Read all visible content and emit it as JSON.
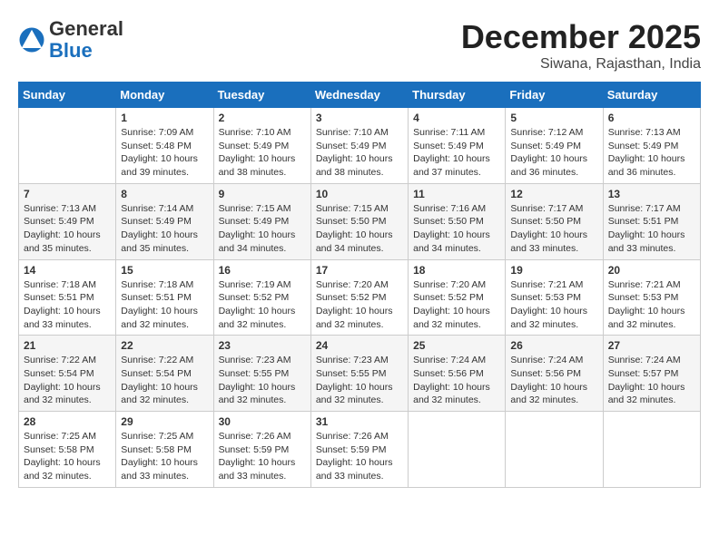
{
  "logo": {
    "general": "General",
    "blue": "Blue"
  },
  "title": "December 2025",
  "location": "Siwana, Rajasthan, India",
  "days_of_week": [
    "Sunday",
    "Monday",
    "Tuesday",
    "Wednesday",
    "Thursday",
    "Friday",
    "Saturday"
  ],
  "weeks": [
    [
      {
        "day": "",
        "info": ""
      },
      {
        "day": "1",
        "info": "Sunrise: 7:09 AM\nSunset: 5:48 PM\nDaylight: 10 hours\nand 39 minutes."
      },
      {
        "day": "2",
        "info": "Sunrise: 7:10 AM\nSunset: 5:49 PM\nDaylight: 10 hours\nand 38 minutes."
      },
      {
        "day": "3",
        "info": "Sunrise: 7:10 AM\nSunset: 5:49 PM\nDaylight: 10 hours\nand 38 minutes."
      },
      {
        "day": "4",
        "info": "Sunrise: 7:11 AM\nSunset: 5:49 PM\nDaylight: 10 hours\nand 37 minutes."
      },
      {
        "day": "5",
        "info": "Sunrise: 7:12 AM\nSunset: 5:49 PM\nDaylight: 10 hours\nand 36 minutes."
      },
      {
        "day": "6",
        "info": "Sunrise: 7:13 AM\nSunset: 5:49 PM\nDaylight: 10 hours\nand 36 minutes."
      }
    ],
    [
      {
        "day": "7",
        "info": "Sunrise: 7:13 AM\nSunset: 5:49 PM\nDaylight: 10 hours\nand 35 minutes."
      },
      {
        "day": "8",
        "info": "Sunrise: 7:14 AM\nSunset: 5:49 PM\nDaylight: 10 hours\nand 35 minutes."
      },
      {
        "day": "9",
        "info": "Sunrise: 7:15 AM\nSunset: 5:49 PM\nDaylight: 10 hours\nand 34 minutes."
      },
      {
        "day": "10",
        "info": "Sunrise: 7:15 AM\nSunset: 5:50 PM\nDaylight: 10 hours\nand 34 minutes."
      },
      {
        "day": "11",
        "info": "Sunrise: 7:16 AM\nSunset: 5:50 PM\nDaylight: 10 hours\nand 34 minutes."
      },
      {
        "day": "12",
        "info": "Sunrise: 7:17 AM\nSunset: 5:50 PM\nDaylight: 10 hours\nand 33 minutes."
      },
      {
        "day": "13",
        "info": "Sunrise: 7:17 AM\nSunset: 5:51 PM\nDaylight: 10 hours\nand 33 minutes."
      }
    ],
    [
      {
        "day": "14",
        "info": "Sunrise: 7:18 AM\nSunset: 5:51 PM\nDaylight: 10 hours\nand 33 minutes."
      },
      {
        "day": "15",
        "info": "Sunrise: 7:18 AM\nSunset: 5:51 PM\nDaylight: 10 hours\nand 32 minutes."
      },
      {
        "day": "16",
        "info": "Sunrise: 7:19 AM\nSunset: 5:52 PM\nDaylight: 10 hours\nand 32 minutes."
      },
      {
        "day": "17",
        "info": "Sunrise: 7:20 AM\nSunset: 5:52 PM\nDaylight: 10 hours\nand 32 minutes."
      },
      {
        "day": "18",
        "info": "Sunrise: 7:20 AM\nSunset: 5:52 PM\nDaylight: 10 hours\nand 32 minutes."
      },
      {
        "day": "19",
        "info": "Sunrise: 7:21 AM\nSunset: 5:53 PM\nDaylight: 10 hours\nand 32 minutes."
      },
      {
        "day": "20",
        "info": "Sunrise: 7:21 AM\nSunset: 5:53 PM\nDaylight: 10 hours\nand 32 minutes."
      }
    ],
    [
      {
        "day": "21",
        "info": "Sunrise: 7:22 AM\nSunset: 5:54 PM\nDaylight: 10 hours\nand 32 minutes."
      },
      {
        "day": "22",
        "info": "Sunrise: 7:22 AM\nSunset: 5:54 PM\nDaylight: 10 hours\nand 32 minutes."
      },
      {
        "day": "23",
        "info": "Sunrise: 7:23 AM\nSunset: 5:55 PM\nDaylight: 10 hours\nand 32 minutes."
      },
      {
        "day": "24",
        "info": "Sunrise: 7:23 AM\nSunset: 5:55 PM\nDaylight: 10 hours\nand 32 minutes."
      },
      {
        "day": "25",
        "info": "Sunrise: 7:24 AM\nSunset: 5:56 PM\nDaylight: 10 hours\nand 32 minutes."
      },
      {
        "day": "26",
        "info": "Sunrise: 7:24 AM\nSunset: 5:56 PM\nDaylight: 10 hours\nand 32 minutes."
      },
      {
        "day": "27",
        "info": "Sunrise: 7:24 AM\nSunset: 5:57 PM\nDaylight: 10 hours\nand 32 minutes."
      }
    ],
    [
      {
        "day": "28",
        "info": "Sunrise: 7:25 AM\nSunset: 5:58 PM\nDaylight: 10 hours\nand 32 minutes."
      },
      {
        "day": "29",
        "info": "Sunrise: 7:25 AM\nSunset: 5:58 PM\nDaylight: 10 hours\nand 33 minutes."
      },
      {
        "day": "30",
        "info": "Sunrise: 7:26 AM\nSunset: 5:59 PM\nDaylight: 10 hours\nand 33 minutes."
      },
      {
        "day": "31",
        "info": "Sunrise: 7:26 AM\nSunset: 5:59 PM\nDaylight: 10 hours\nand 33 minutes."
      },
      {
        "day": "",
        "info": ""
      },
      {
        "day": "",
        "info": ""
      },
      {
        "day": "",
        "info": ""
      }
    ]
  ]
}
